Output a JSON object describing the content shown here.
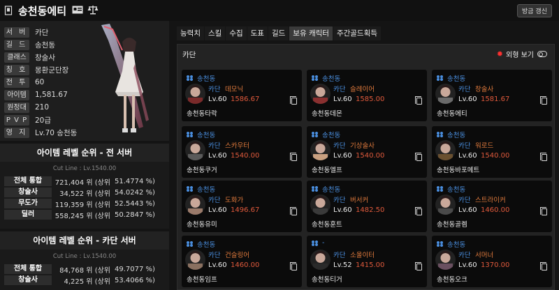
{
  "header": {
    "title": "송천동에티",
    "refresh_label": "방금 갱신"
  },
  "profile": {
    "rows": [
      {
        "label": "서 버",
        "value": "카단"
      },
      {
        "label": "길 드",
        "value": "송천동"
      },
      {
        "label": "클래스",
        "value": "창술사"
      },
      {
        "label": "칭 호",
        "value": "몽환군단장"
      },
      {
        "label": "전 투",
        "value": "60"
      },
      {
        "label": "아이템",
        "value": "1,581.67"
      },
      {
        "label": "원정대",
        "value": "210"
      },
      {
        "label": "P V P",
        "value": "20급"
      },
      {
        "label": "영 지",
        "value": "Lv.70 송천동"
      }
    ]
  },
  "rank_all": {
    "title": "아이템 레벨 순위 - 전 서버",
    "cutline": "Cut Line : Lv.1540.00",
    "rows": [
      {
        "label": "전체 통합",
        "value": "721,404 위 (상위",
        "pct": "51.4774 %)"
      },
      {
        "label": "창술사",
        "value": "34,522 위 (상위",
        "pct": "54.0242 %)"
      },
      {
        "label": "무도가",
        "value": "119,359 위 (상위",
        "pct": "52.5443 %)"
      },
      {
        "label": "딜러",
        "value": "558,245 위 (상위",
        "pct": "50.2847 %)"
      }
    ]
  },
  "rank_server": {
    "title": "아이템 레벨 순위 - 카단 서버",
    "cutline": "Cut Line : Lv.1540.00",
    "rows": [
      {
        "label": "전체 통합",
        "value": "84,768 위 (상위",
        "pct": "49.7077 %)"
      },
      {
        "label": "창술사",
        "value": "4,225 위 (상위",
        "pct": "53.4066 %)"
      }
    ]
  },
  "tabs": [
    "능력치",
    "스킬",
    "수집",
    "도표",
    "길드",
    "보유 캐릭터",
    "주간골드획득"
  ],
  "panel": {
    "server": "카단",
    "appearance_label": "외형 보기"
  },
  "cards": [
    {
      "guild": "송천동",
      "server": "카단",
      "class": "데모닉",
      "level": "Lv.60",
      "ilvl": "1586.67",
      "name": "송천동타락",
      "color": "#7a2a2a"
    },
    {
      "guild": "송천동",
      "server": "카단",
      "class": "슬레이어",
      "level": "Lv.60",
      "ilvl": "1585.00",
      "name": "송천동데몬",
      "color": "#8a3030"
    },
    {
      "guild": "송천동",
      "server": "카단",
      "class": "창술사",
      "level": "Lv.60",
      "ilvl": "1581.67",
      "name": "송천동에티",
      "color": "#6a6a6a"
    },
    {
      "guild": "송천동",
      "server": "카단",
      "class": "스카우터",
      "level": "Lv.60",
      "ilvl": "1540.00",
      "name": "송천동쿠거",
      "color": "#5a5a5a"
    },
    {
      "guild": "송천동",
      "server": "카단",
      "class": "기상술사",
      "level": "Lv.60",
      "ilvl": "1540.00",
      "name": "송천동엘프",
      "color": "#c9a080"
    },
    {
      "guild": "송천동",
      "server": "카단",
      "class": "워로드",
      "level": "Lv.60",
      "ilvl": "1540.00",
      "name": "송천동바포메트",
      "color": "#6a5030"
    },
    {
      "guild": "송천동",
      "server": "카단",
      "class": "도화가",
      "level": "Lv.60",
      "ilvl": "1496.67",
      "name": "송천동유미",
      "color": "#9a7a6a"
    },
    {
      "guild": "송천동",
      "server": "카단",
      "class": "버서커",
      "level": "Lv.60",
      "ilvl": "1482.50",
      "name": "송천동훈트",
      "color": "#3a3a3a"
    },
    {
      "guild": "송천동",
      "server": "카단",
      "class": "스트라이커",
      "level": "Lv.60",
      "ilvl": "1460.00",
      "name": "송천동골렘",
      "color": "#4a4a4a"
    },
    {
      "guild": "송천동",
      "server": "카단",
      "class": "건슬링어",
      "level": "Lv.60",
      "ilvl": "1460.00",
      "name": "송천동임프",
      "color": "#8a7060"
    },
    {
      "guild": "-",
      "server": "카단",
      "class": "소울이터",
      "level": "Lv.52",
      "ilvl": "1415.00",
      "name": "송천동티거",
      "color": "#2a2a2a"
    },
    {
      "guild": "송천동",
      "server": "카단",
      "class": "서머너",
      "level": "Lv.60",
      "ilvl": "1370.00",
      "name": "송천동오크",
      "color": "#6a5060"
    }
  ]
}
